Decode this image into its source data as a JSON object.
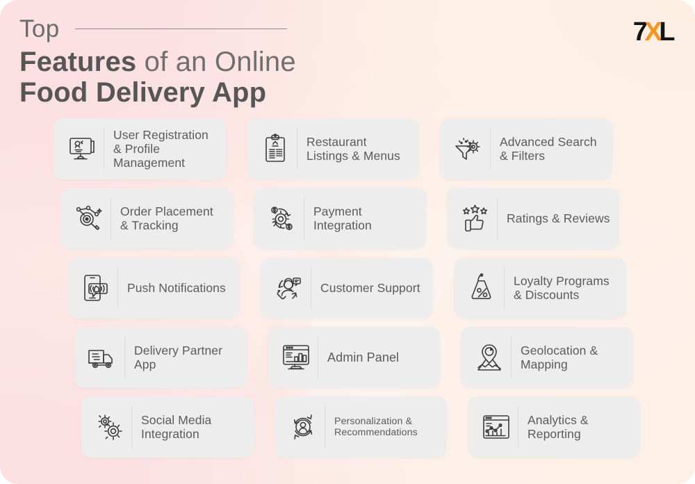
{
  "header": {
    "kicker": "Top",
    "title_line1_bold": "Features",
    "title_line1_light": " of an Online",
    "title_line2": "Food Delivery App"
  },
  "logo": {
    "part1": "7",
    "part2": "X",
    "part3": "L",
    "accent_color": "#f7941d",
    "dark_color": "#151515"
  },
  "theme": {
    "background_pink": "#fce3e5",
    "background_cream": "#fdf0e6",
    "card_background": "#ededed",
    "text_color": "#5b5b5b",
    "icon_color": "#3b3b3b",
    "divider_color": "#dcdcdc"
  },
  "features": [
    {
      "id": 1,
      "label": "User Registration & Profile Management",
      "icon": "monitor-user-icon",
      "row": 1,
      "col": 1
    },
    {
      "id": 2,
      "label": "Restaurant Listings & Menus",
      "icon": "clipboard-menu-icon",
      "row": 1,
      "col": 2
    },
    {
      "id": 3,
      "label": "Advanced Search & Filters",
      "icon": "funnel-gear-icon",
      "row": 1,
      "col": 3
    },
    {
      "id": 4,
      "label": "Order Placement & Tracking",
      "icon": "order-tracking-icon",
      "row": 2,
      "col": 1
    },
    {
      "id": 5,
      "label": "Payment Integration",
      "icon": "payment-gear-icon",
      "row": 2,
      "col": 2
    },
    {
      "id": 6,
      "label": "Ratings & Reviews",
      "icon": "stars-thumbsup-icon",
      "row": 2,
      "col": 3
    },
    {
      "id": 7,
      "label": "Push Notifications",
      "icon": "phone-bell-icon",
      "row": 3,
      "col": 1
    },
    {
      "id": 8,
      "label": "Customer Support",
      "icon": "headset-agent-icon",
      "row": 3,
      "col": 2
    },
    {
      "id": 9,
      "label": "Loyalty Programs & Discounts",
      "icon": "discount-tag-icon",
      "row": 3,
      "col": 3
    },
    {
      "id": 10,
      "label": "Delivery Partner App",
      "icon": "delivery-truck-icon",
      "row": 4,
      "col": 1
    },
    {
      "id": 11,
      "label": "Admin Panel",
      "icon": "dashboard-monitor-icon",
      "row": 4,
      "col": 2
    },
    {
      "id": 12,
      "label": "Geolocation & Mapping",
      "icon": "map-pin-icon",
      "row": 4,
      "col": 3
    },
    {
      "id": 13,
      "label": "Social Media Integration",
      "icon": "gears-icon",
      "row": 5,
      "col": 1
    },
    {
      "id": 14,
      "label": "Personalization & Recommendations",
      "icon": "user-refresh-icon",
      "row": 5,
      "col": 2
    },
    {
      "id": 15,
      "label": "Analytics & Reporting",
      "icon": "analytics-chart-icon",
      "row": 5,
      "col": 3
    }
  ]
}
